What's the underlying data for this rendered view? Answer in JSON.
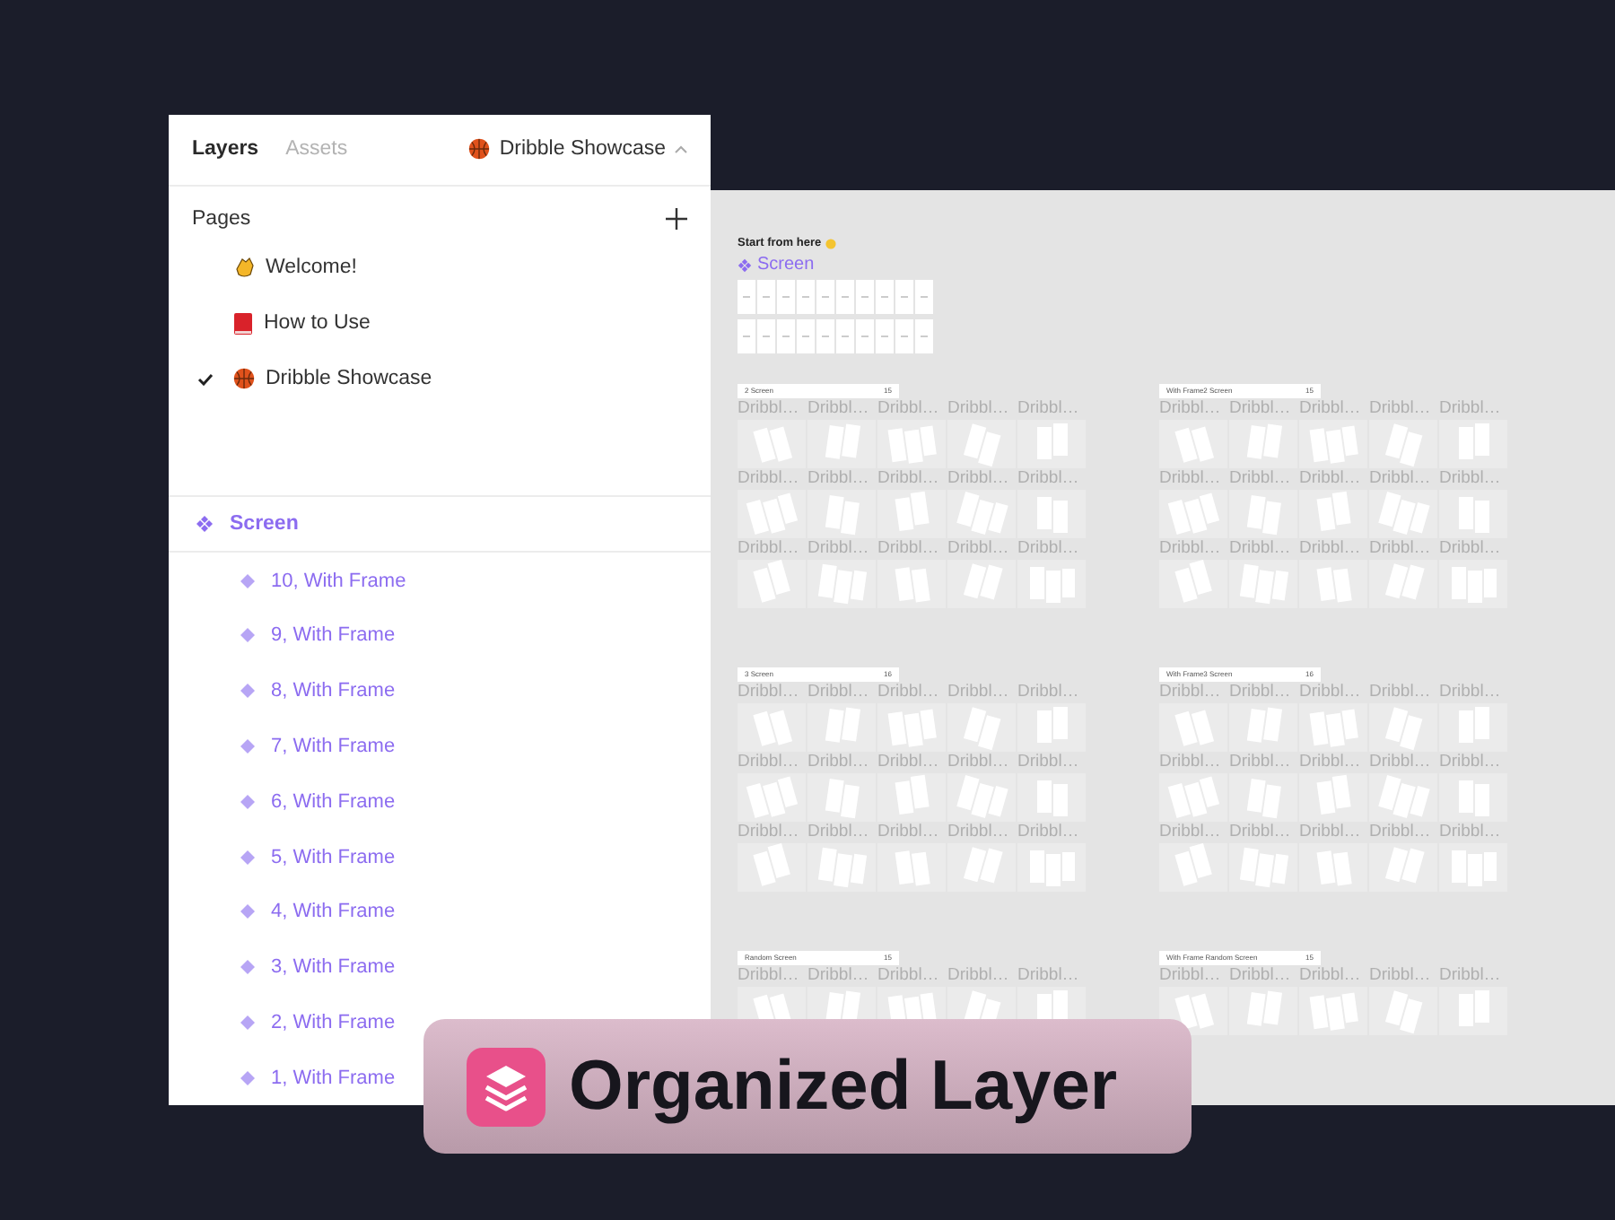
{
  "panel": {
    "tabs": [
      {
        "label": "Layers",
        "selected": true
      },
      {
        "label": "Assets",
        "selected": false
      }
    ],
    "page_switcher": {
      "label": "Dribble Showcase",
      "kind": "ball"
    },
    "pages_title": "Pages",
    "pages": [
      {
        "label": "Welcome!",
        "kind": "hands",
        "selected": false
      },
      {
        "label": "How to Use",
        "kind": "book",
        "selected": false
      },
      {
        "label": "Dribble Showcase",
        "kind": "ball",
        "selected": true
      }
    ],
    "layers": [
      {
        "label": "Screen",
        "children": [
          {
            "label": "10, With Frame"
          },
          {
            "label": "9, With Frame"
          },
          {
            "label": "8, With Frame"
          },
          {
            "label": "7, With Frame"
          },
          {
            "label": "6, With Frame"
          },
          {
            "label": "5, With Frame"
          },
          {
            "label": "4, With Frame"
          },
          {
            "label": "3, With Frame"
          },
          {
            "label": "2, With Frame"
          },
          {
            "label": "1, With Frame"
          }
        ]
      }
    ]
  },
  "canvas": {
    "start_label": "Start from here",
    "component_label": "Screen",
    "sections": [
      {
        "title": "2 Screen",
        "count": "15",
        "rows": [
          [
            "Dribbl…",
            "Dribbl…",
            "Dribbl…",
            "Dribbl…",
            "Dribbl…"
          ],
          [
            "Dribbl…",
            "Dribbl…",
            "Dribbl…",
            "Dribbl…",
            "Dribbl…"
          ],
          [
            "Dribbl…",
            "Dribbl…",
            "Dribbl…",
            "Dribbl…",
            "Dribbl…"
          ]
        ]
      },
      {
        "title": "With Frame2 Screen",
        "count": "15",
        "rows": [
          [
            "Dribbl…",
            "Dribbl…",
            "Dribbl…",
            "Dribbl…",
            "Dribbl…"
          ],
          [
            "Dribbl…",
            "Dribbl…",
            "Dribbl…",
            "Dribbl…",
            "Dribbl…"
          ],
          [
            "Dribbl…",
            "Dribbl…",
            "Dribbl…",
            "Dribbl…",
            "Dribbl…"
          ]
        ]
      },
      {
        "title": "3 Screen",
        "count": "16",
        "rows": [
          [
            "Dribbl…",
            "Dribbl…",
            "Dribbl…",
            "Dribbl…",
            "Dribbl…"
          ],
          [
            "Dribbl…",
            "Dribbl…",
            "Dribbl…",
            "Dribbl…",
            "Dribbl…"
          ],
          [
            "Dribbl…",
            "Dribbl…",
            "Dribbl…",
            "Dribbl…",
            "Dribbl…"
          ]
        ]
      },
      {
        "title": "With Frame3 Screen",
        "count": "16",
        "rows": [
          [
            "Dribbl…",
            "Dribbl…",
            "Dribbl…",
            "Dribbl…",
            "Dribbl…"
          ],
          [
            "Dribbl…",
            "Dribbl…",
            "Dribbl…",
            "Dribbl…",
            "Dribbl…"
          ],
          [
            "Dribbl…",
            "Dribbl…",
            "Dribbl…",
            "Dribbl…",
            "Dribbl…"
          ]
        ]
      },
      {
        "title": "Random Screen",
        "count": "15",
        "rows": [
          [
            "Dribbl…",
            "Dribbl…",
            "Dribbl…",
            "Dribbl…",
            "Dribbl…"
          ]
        ]
      },
      {
        "title": "With Frame Random Screen",
        "count": "15",
        "rows": [
          [
            "Dribbl…",
            "Dribbl…",
            "Dribbl…",
            "Dribbl…",
            "Dribbl…"
          ]
        ]
      }
    ]
  },
  "banner": {
    "title": "Organized Layer"
  }
}
